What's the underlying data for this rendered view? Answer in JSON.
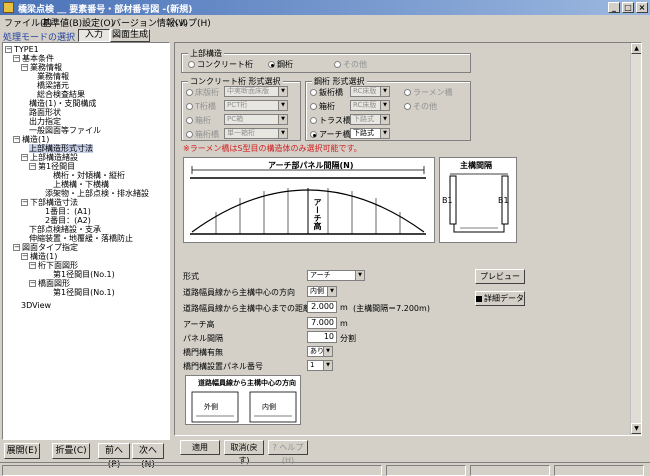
{
  "window": {
    "title": "橋梁点検 ＿ 要素番号・部材番号図 -(新規)"
  },
  "menu": [
    "ファイル(F)",
    "基準値(B)",
    "設定(O)",
    "バージョン情報(V)",
    "ヘルプ(H)"
  ],
  "toolbar": {
    "mode_label": "処理モードの選択",
    "input_label": "入力",
    "generate_label": "図面生成"
  },
  "tree": [
    "TYPE1",
    "基本条件",
    "業務情報",
    "業務情報",
    "橋梁諸元",
    "総合検査結果",
    "構造(1)・支間構成",
    "路面形状",
    "出力指定",
    "一般図面等ファイル",
    "構造(1)",
    "上部構造形式寸法",
    "上部構造緒設",
    "第1径間目",
    "横桁・対傾構・縦桁",
    "上横構・下横構",
    "添架物・上部点検・排水緒設",
    "下部構造寸法",
    "1番目：(A1)",
    "2番目：(A2)",
    "下部点検緒設・支承",
    "伸縮装置・地覆緩・落橋防止",
    "図面タイプ指定",
    "構造(1)",
    "桁下面図形",
    "第1径間目(No.1)",
    "橋面図形",
    "第1径間目(No.1)",
    "3DView"
  ],
  "nav": {
    "expand": "展開(E)",
    "collapse": "折畳(C)",
    "prev": "前へ(P)",
    "next": "次へ(N)"
  },
  "upper": {
    "title": "上部構造",
    "concrete": "コンクリート桁",
    "steel": "鋼桁",
    "other": "その他"
  },
  "concrete_group": {
    "title": "コンクリート桁 形式選択",
    "rows": [
      {
        "label": "床版桁",
        "value": "中実断面床版"
      },
      {
        "label": "T桁橋",
        "value": "PCT桁"
      },
      {
        "label": "箱桁",
        "value": "PC箱"
      },
      {
        "label": "箱桁橋",
        "value": "単一箱桁"
      }
    ]
  },
  "steel_group": {
    "title": "鋼桁 形式選択",
    "rows": [
      {
        "label": "鈑桁橋",
        "value": "RC床版"
      },
      {
        "label": "箱桁",
        "value": "RC床版"
      },
      {
        "label": "トラス橋",
        "value": "下路式"
      },
      {
        "label": "アーチ橋",
        "value": "下路式"
      }
    ],
    "right": [
      "ラーメン橋",
      "その他"
    ]
  },
  "warning": "※ラーメン橋はS型目の構造体のみ選択可能です。",
  "diagram": {
    "title": "アーチ部パネル間隔(N)",
    "arch_label": "アーチ高",
    "panel_title": "主構間隔",
    "b1": "B1"
  },
  "fields": {
    "form_label": "形式",
    "form_value": "アーチ",
    "dir_label": "道路幅員線から主構中心の方向",
    "dir_value": "内側",
    "dist_label": "道路幅員線から主構中心までの距離(B1)",
    "dist_value": "2.000",
    "dist_unit": "m",
    "dist_note": "(主構間隔＝7.200m)",
    "arch_label": "アーチ高",
    "arch_value": "7.000",
    "arch_unit": "m",
    "panel_label": "パネル間隔",
    "panel_value": "10",
    "panel_unit": "分割",
    "cross_label": "橋門構有無",
    "cross_value": "あり",
    "crosspanel_label": "橋門構設置パネル番号",
    "crosspanel_value": "1"
  },
  "mini": {
    "title": "道路幅員線から主構中心の方向",
    "outer": "外側",
    "inner": "内側"
  },
  "buttons": {
    "preview": "プレビュー",
    "detail": "詳細データ",
    "apply": "適用",
    "cancel": "取消(戻す)",
    "help": "ヘルプ(H)"
  }
}
